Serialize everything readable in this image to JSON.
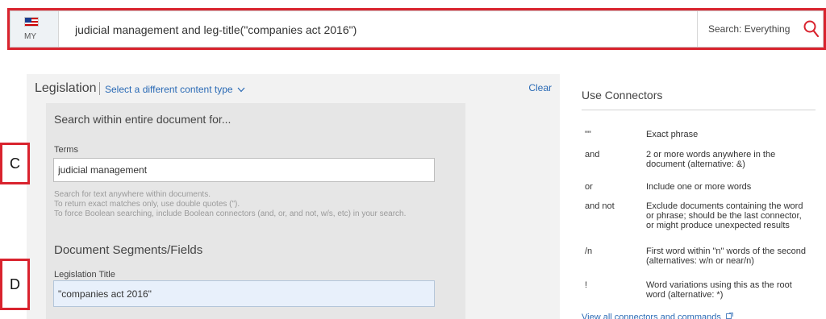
{
  "search_bar": {
    "jurisdiction_code": "MY",
    "query": "judicial management and leg-title(\"companies act 2016\")",
    "scope_label": "Search: Everything",
    "accent_color": "#d9232e"
  },
  "legislation_panel": {
    "title": "Legislation",
    "content_type_link": "Select a different content type",
    "clear_label": "Clear",
    "search_within": "Search within entire document for...",
    "terms_label": "Terms",
    "terms_value": "judicial management",
    "help_lines": [
      "Search for text anywhere within documents.",
      "To return exact matches only, use double quotes (\").",
      "To force Boolean searching, include Boolean connectors (and, or, and not, w/s, etc) in your search."
    ],
    "segments_heading": "Document Segments/Fields",
    "legislation_title_label": "Legislation Title",
    "legislation_title_value": "\"companies act 2016\""
  },
  "callouts": {
    "c": "C",
    "d": "D"
  },
  "connectors": {
    "title": "Use Connectors",
    "items": [
      {
        "key": "\"\"",
        "desc": "Exact phrase"
      },
      {
        "key": "and",
        "desc": "2 or more words anywhere in the document (alternative: &)"
      },
      {
        "key": "or",
        "desc": "Include one or more words"
      },
      {
        "key": "and not",
        "desc": "Exclude documents containing the word or phrase; should be the last connector, or might produce unexpected results"
      },
      {
        "key": "/n",
        "desc": "First word within \"n\" words of the second (alternatives: w/n or near/n)"
      },
      {
        "key": "!",
        "desc": "Word variations using this as the root word (alternative: *)"
      }
    ],
    "view_all_link": "View all connectors and commands"
  }
}
